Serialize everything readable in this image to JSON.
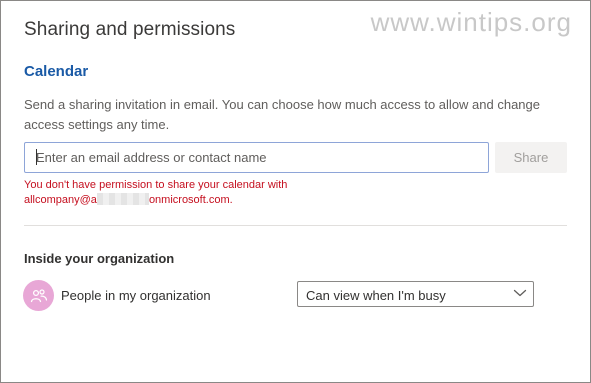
{
  "dialog": {
    "title": "Sharing and permissions"
  },
  "watermark": "www.wintips.org",
  "calendar": {
    "heading": "Calendar",
    "description": "Send a sharing invitation in email. You can choose how much access to allow and change access settings any time.",
    "email_input": {
      "value": "",
      "placeholder": "Enter an email address or contact name"
    },
    "share_button": "Share",
    "error_line1": "You don't have permission to share your calendar with",
    "error_line2_prefix": "allcompany@a",
    "error_line2_suffix": "onmicrosoft.com."
  },
  "organization": {
    "heading": "Inside your organization",
    "item_label": "People in my organization",
    "permission": "Can view when I'm busy",
    "avatar_icon": "people-icon"
  },
  "colors": {
    "accent": "#1a5aa6",
    "error": "#c50f1f",
    "avatar": "#e8a7d6"
  }
}
